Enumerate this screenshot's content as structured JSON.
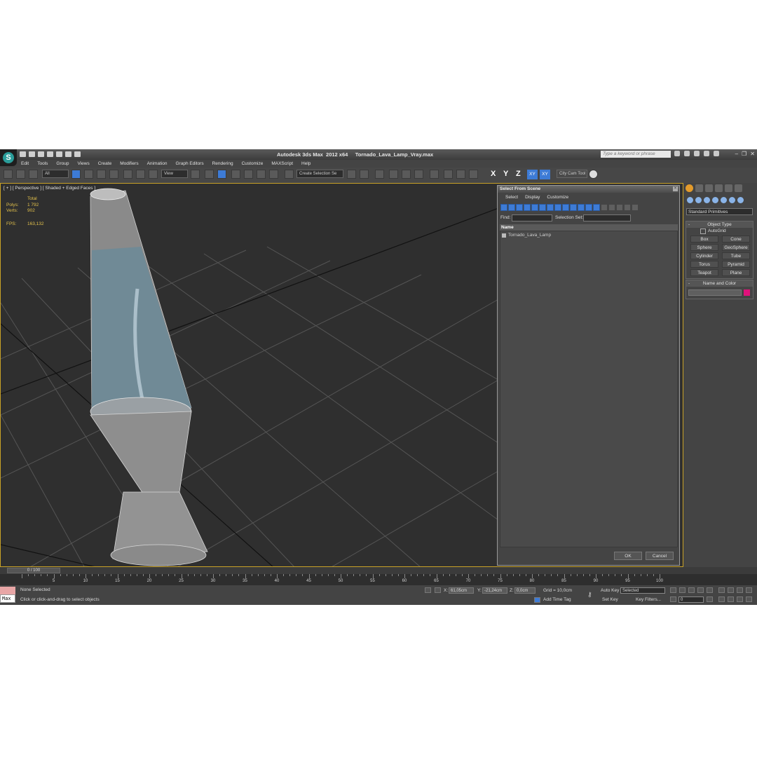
{
  "app": {
    "title": "Autodesk 3ds Max  2012 x64     Tornado_Lava_Lamp_Vray.max",
    "search_placeholder": "Type a keyword or phrase"
  },
  "menu": [
    "Edit",
    "Tools",
    "Group",
    "Views",
    "Create",
    "Modifiers",
    "Animation",
    "Graph Editors",
    "Rendering",
    "Customize",
    "MAXScript",
    "Help"
  ],
  "toolbar": {
    "filter_dropdown": "All",
    "view_dropdown": "View",
    "selection_set": "Create Selection Se",
    "axis_x": "X",
    "axis_y": "Y",
    "axis_z": "Z",
    "axis_xy": "XY",
    "axis_xy2": "XY",
    "city_tool": "City Cam Tool"
  },
  "viewport": {
    "label": "[ + ] [ Perspective ] [ Shaded + Edged Faces ]",
    "stats_total": "Total",
    "polys_label": "Polys:",
    "polys_value": "1 792",
    "verts_label": "Verts:",
    "verts_value": "902",
    "fps_label": "FPS:",
    "fps_value": "163,132"
  },
  "dialog": {
    "title": "Select From Scene",
    "menu": [
      "Select",
      "Display",
      "Customize"
    ],
    "find_label": "Find:",
    "selset_label": "Selection Set:",
    "column_name": "Name",
    "items": [
      "Tornado_Lava_Lamp"
    ],
    "ok": "OK",
    "cancel": "Cancel"
  },
  "command_panel": {
    "category": "Standard Primitives",
    "object_type_title": "Object Type",
    "autogrid": "AutoGrid",
    "objects": [
      "Box",
      "Cone",
      "Sphere",
      "GeoSphere",
      "Cylinder",
      "Tube",
      "Torus",
      "Pyramid",
      "Teapot",
      "Plane"
    ],
    "name_color_title": "Name and Color",
    "object_color": "#e0127b"
  },
  "timeline": {
    "frame_counter": "0 / 100",
    "ticks": [
      "5",
      "10",
      "15",
      "20",
      "25",
      "30",
      "35",
      "40",
      "45",
      "50",
      "55",
      "60",
      "65",
      "70",
      "75",
      "80",
      "85",
      "90",
      "95",
      "100"
    ]
  },
  "status": {
    "maxscript": "Max",
    "selection": "None Selected",
    "prompt": "Click or click-and-drag to select objects",
    "x_label": "X:",
    "x_value": "61,05cm",
    "y_label": "Y:",
    "y_value": "-21,24cm",
    "z_label": "Z:",
    "z_value": "0,0cm",
    "grid": "Grid = 10,0cm",
    "add_time_tag": "Add Time Tag",
    "auto_key": "Auto Key",
    "set_key": "Set Key",
    "key_mode": "Selected",
    "key_filters": "Key Filters...",
    "current_frame": "0"
  }
}
